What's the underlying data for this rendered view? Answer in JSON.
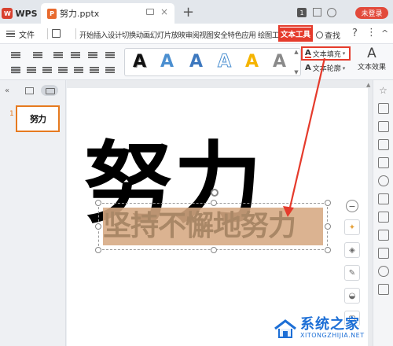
{
  "titlebar": {
    "app_tab": "WPS",
    "doc_tab": "努力.pptx",
    "new_tab": "+",
    "badge": "1",
    "login": "未登录"
  },
  "menubar": {
    "file": "文件",
    "items_text": "开始插入设计切换动画幻灯片放映审阅视图安全特色应用 绘图工具",
    "text_tools": "文本工具",
    "find": "查找",
    "help": "?",
    "more": "⋮",
    "collapse": "^"
  },
  "ribbon": {
    "styles": [
      {
        "glyph": "A",
        "color": "#111111"
      },
      {
        "glyph": "A",
        "color": "#4b8fd0"
      },
      {
        "glyph": "A",
        "color": "#3d78bf"
      },
      {
        "glyph": "A",
        "color": "#ffffff"
      },
      {
        "glyph": "A",
        "color": "#f5b400"
      },
      {
        "glyph": "A",
        "color": "#8a8a8a"
      }
    ],
    "text_fill": "文本填充",
    "text_outline": "文本轮廓",
    "text_effect": "文本效果"
  },
  "left_panel": {
    "slide_number": "1",
    "thumb_text": "努力"
  },
  "slide": {
    "title": "努力",
    "selected_text": "坚持不懈地努力"
  },
  "watermark": {
    "cn": "系统之家",
    "en": "XITONGZHIJIA.NET"
  },
  "colors": {
    "accent_red": "#e53b2c",
    "selection_fill": "#d6a982",
    "watermark_blue": "#1d6fd6"
  }
}
